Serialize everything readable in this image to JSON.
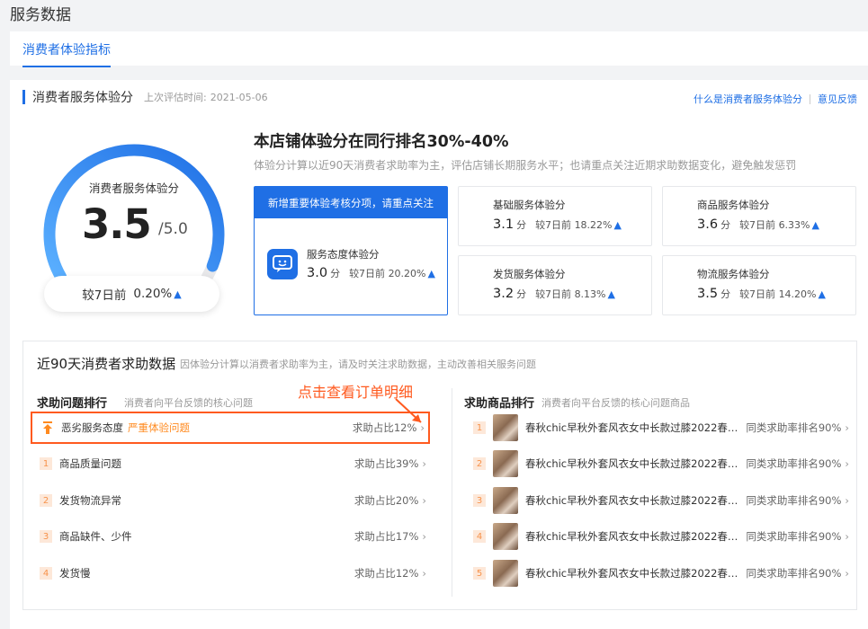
{
  "page": {
    "title": "服务数据"
  },
  "tabs": [
    {
      "label": "消费者体验指标",
      "active": true
    }
  ],
  "section": {
    "title": "消费者服务体验分",
    "eval_prefix": "上次评估时间:",
    "eval_date": "2021-05-06",
    "links": [
      "什么是消费者服务体验分",
      "意见反馈"
    ]
  },
  "gauge": {
    "label": "消费者服务体验分",
    "score": "3.5",
    "max": "/5.0",
    "score_value": 3.5,
    "max_value": 5.0,
    "compare_label": "较7日前",
    "compare_value": "0.20%",
    "colors": {
      "start": "#5bb0ff",
      "end": "#1f6fe5",
      "track": "#e8e8ea"
    }
  },
  "rank": {
    "title": "本店铺体验分在同行排名30%-40%",
    "desc": "体验分计算以近90天消费者求助率为主，评估店铺长期服务水平；也请重点关注近期求助数据变化，避免触发惩罚"
  },
  "focus_card": {
    "header": "新增重要体验考核分项，请重点关注",
    "icon": "chat-face-icon",
    "label": "服务态度体验分",
    "score": "3.0",
    "unit": "分",
    "compare": "较7日前",
    "change": "20.20%"
  },
  "metrics": [
    {
      "label": "基础服务体验分",
      "score": "3.1",
      "unit": "分",
      "compare": "较7日前",
      "change": "18.22%"
    },
    {
      "label": "商品服务体验分",
      "score": "3.6",
      "unit": "分",
      "compare": "较7日前",
      "change": "6.33%"
    },
    {
      "label": "发货服务体验分",
      "score": "3.2",
      "unit": "分",
      "compare": "较7日前",
      "change": "8.13%"
    },
    {
      "label": "物流服务体验分",
      "score": "3.5",
      "unit": "分",
      "compare": "较7日前",
      "change": "14.20%"
    }
  ],
  "help": {
    "title": "近90天消费者求助数据",
    "subtitle": "因体验分计算以消费者求助率为主，请及时关注求助数据，主动改善相关服务问题",
    "annotation": "点击查看订单明细",
    "problems": {
      "title": "求助问题排行",
      "subtitle": "消费者向平台反馈的核心问题",
      "items": [
        {
          "rank": "top",
          "label": "恶劣服务态度",
          "tag": "严重体验问题",
          "ratio": "求助占比12%"
        },
        {
          "rank": "1",
          "label": "商品质量问题",
          "tag": "",
          "ratio": "求助占比39%"
        },
        {
          "rank": "2",
          "label": "发货物流异常",
          "tag": "",
          "ratio": "求助占比20%"
        },
        {
          "rank": "3",
          "label": "商品缺件、少件",
          "tag": "",
          "ratio": "求助占比17%"
        },
        {
          "rank": "4",
          "label": "发货慢",
          "tag": "",
          "ratio": "求助占比12%"
        }
      ]
    },
    "products": {
      "title": "求助商品排行",
      "subtitle": "消费者向平台反馈的核心问题商品",
      "items": [
        {
          "rank": "1",
          "name": "春秋chic早秋外套风衣女中长款过膝2022春秋...",
          "stat": "同类求助率排名90%"
        },
        {
          "rank": "2",
          "name": "春秋chic早秋外套风衣女中长款过膝2022春秋...",
          "stat": "同类求助率排名90%"
        },
        {
          "rank": "3",
          "name": "春秋chic早秋外套风衣女中长款过膝2022春秋...",
          "stat": "同类求助率排名90%"
        },
        {
          "rank": "4",
          "name": "春秋chic早秋外套风衣女中长款过膝2022春秋...",
          "stat": "同类求助率排名90%"
        },
        {
          "rank": "5",
          "name": "春秋chic早秋外套风衣女中长款过膝2022春秋...",
          "stat": "同类求助率排名90%"
        }
      ]
    }
  },
  "colors": {
    "accent": "#1f6fe5",
    "highlight": "#ff5a1f",
    "warning": "#ff8a1f"
  }
}
